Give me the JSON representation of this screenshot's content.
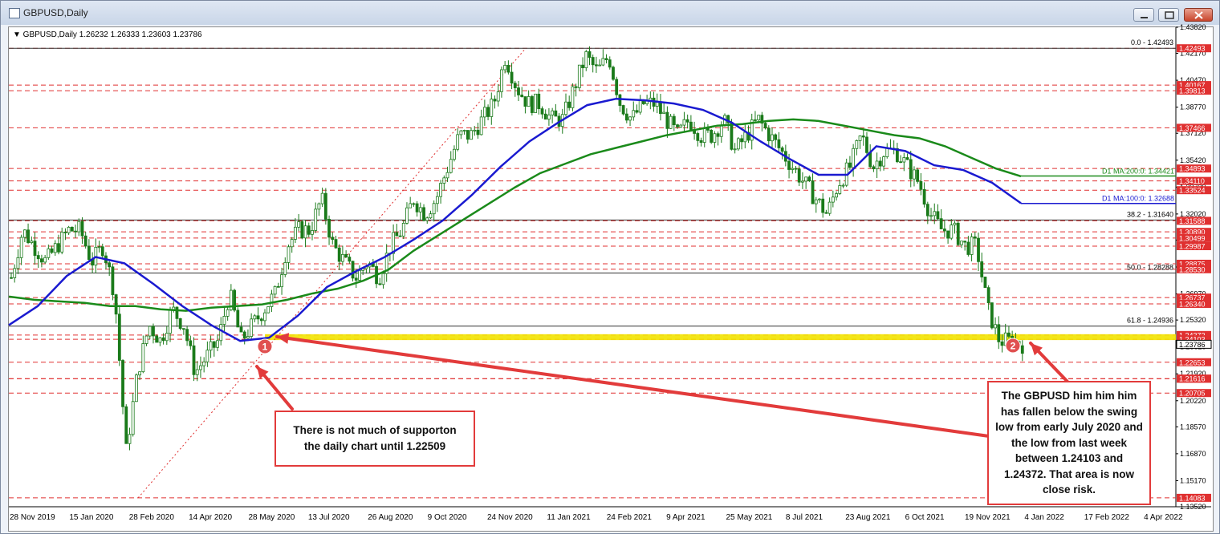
{
  "window": {
    "title": "GBPUSD,Daily",
    "buttons": [
      "minimize",
      "maximize",
      "close"
    ]
  },
  "chart_data": {
    "type": "candlestick",
    "symbol_info": "GBPUSD,Daily  1.26232 1.26333 1.23603 1.23786",
    "current_price": 1.23786,
    "ylim": [
      1.1352,
      1.4382
    ],
    "price_axis_ticks": [
      "1.43820",
      "1.42170",
      "1.40470",
      "1.38770",
      "1.37120",
      "1.35420",
      "1.33720",
      "1.32020",
      "1.30370",
      "1.28670",
      "1.26970",
      "1.25320",
      "1.23620",
      "1.21920",
      "1.20220",
      "1.18570",
      "1.16870",
      "1.15170",
      "1.13520"
    ],
    "x_ticks": [
      "28 Nov 2019",
      "15 Jan 2020",
      "28 Feb 2020",
      "14 Apr 2020",
      "28 May 2020",
      "13 Jul 2020",
      "26 Aug 2020",
      "9 Oct 2020",
      "24 Nov 2020",
      "11 Jan 2021",
      "24 Feb 2021",
      "9 Apr 2021",
      "25 May 2021",
      "8 Jul 2021",
      "23 Aug 2021",
      "6 Oct 2021",
      "19 Nov 2021",
      "4 Jan 2022",
      "17 Feb 2022",
      "4 Apr 2022"
    ],
    "red_levels": [
      "1.42493",
      "1.40167",
      "1.39813",
      "1.37466",
      "1.34893",
      "1.34110",
      "1.33524",
      "1.31588",
      "1.30890",
      "1.30499",
      "1.29987",
      "1.28875",
      "1.28530",
      "1.26737",
      "1.26340",
      "1.24372",
      "1.24103",
      "1.22653",
      "1.21610",
      "1.21616",
      "1.20705",
      "1.14083"
    ],
    "horizontal_lines": [
      {
        "value": 1.42493,
        "label": "0.0 - 1.42493"
      },
      {
        "value": 1.3164,
        "label": "38.2 - 1.31640"
      },
      {
        "value": 1.28288,
        "label": "50.0 - 1.28288"
      },
      {
        "value": 1.24936,
        "label": "61.8 - 1.24936"
      }
    ],
    "moving_averages": [
      {
        "name": "D1 MA:200:0: 1.34421",
        "color": "#1a8a1a",
        "end_value": 1.34421,
        "values": [
          1.268,
          1.266,
          1.265,
          1.264,
          1.262,
          1.262,
          1.26,
          1.259,
          1.261,
          1.262,
          1.263,
          1.266,
          1.27,
          1.273,
          1.278,
          1.285,
          1.297,
          1.307,
          1.317,
          1.327,
          1.337,
          1.346,
          1.352,
          1.358,
          1.362,
          1.366,
          1.37,
          1.373,
          1.376,
          1.377,
          1.379,
          1.38,
          1.379,
          1.376,
          1.373,
          1.37,
          1.368,
          1.363,
          1.356,
          1.349,
          1.344
        ]
      },
      {
        "name": "D1 MA:100:0: 1.32688",
        "color": "#1a1ad0",
        "end_value": 1.32688,
        "values": [
          1.25,
          1.262,
          1.281,
          1.293,
          1.289,
          1.276,
          1.262,
          1.25,
          1.24,
          1.242,
          1.256,
          1.274,
          1.284,
          1.293,
          1.304,
          1.316,
          1.332,
          1.35,
          1.366,
          1.378,
          1.389,
          1.393,
          1.392,
          1.39,
          1.386,
          1.378,
          1.366,
          1.355,
          1.345,
          1.345,
          1.363,
          1.36,
          1.351,
          1.348,
          1.34,
          1.327
        ]
      }
    ],
    "supports": [
      1.24103,
      1.24372
    ],
    "markers": [
      {
        "label": "1"
      },
      {
        "label": "2"
      }
    ],
    "close_path": [
      1.28,
      1.31,
      1.3,
      1.29,
      1.3,
      1.31,
      1.31,
      1.29,
      1.3,
      1.27,
      1.17,
      1.22,
      1.25,
      1.24,
      1.26,
      1.25,
      1.22,
      1.23,
      1.24,
      1.27,
      1.24,
      1.25,
      1.26,
      1.27,
      1.3,
      1.31,
      1.31,
      1.33,
      1.3,
      1.29,
      1.28,
      1.29,
      1.28,
      1.3,
      1.31,
      1.33,
      1.32,
      1.33,
      1.35,
      1.37,
      1.37,
      1.38,
      1.39,
      1.42,
      1.4,
      1.39,
      1.39,
      1.38,
      1.38,
      1.4,
      1.42,
      1.41,
      1.42,
      1.39,
      1.38,
      1.39,
      1.39,
      1.38,
      1.37,
      1.38,
      1.37,
      1.37,
      1.38,
      1.36,
      1.37,
      1.38,
      1.37,
      1.36,
      1.35,
      1.34,
      1.33,
      1.32,
      1.34,
      1.35,
      1.37,
      1.35,
      1.36,
      1.36,
      1.35,
      1.34,
      1.32,
      1.31,
      1.31,
      1.3,
      1.3,
      1.26,
      1.24,
      1.24,
      1.238
    ]
  },
  "annotations": {
    "callout_1": "There is not much of supporton the daily chart until 1.22509",
    "callout_2": "The GBPUSD him him him has fallen below the swing low from early July 2020 and the low from last week between 1.24103 and 1.24372. That area is now close risk."
  }
}
